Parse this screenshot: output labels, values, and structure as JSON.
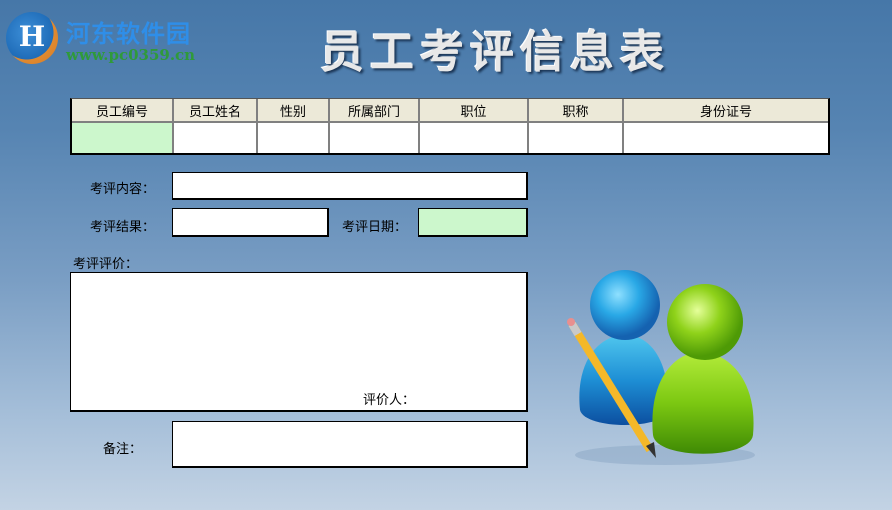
{
  "watermark": {
    "name": "河东软件园",
    "url": "www.pc0359.cn"
  },
  "header": {
    "title": "员工考评信息表"
  },
  "employee_table": {
    "columns": [
      "员工编号",
      "员工姓名",
      "性别",
      "所属部门",
      "职位",
      "职称",
      "身份证号"
    ],
    "row": [
      "",
      "",
      "",
      "",
      "",
      "",
      ""
    ]
  },
  "form": {
    "content_label": "考评内容：",
    "content_value": "",
    "result_label": "考评结果：",
    "result_value": "",
    "date_label": "考评日期：",
    "date_value": "",
    "evaluation_label": "考评评价：",
    "evaluation_value": "",
    "evaluator_label": "评价人：",
    "remarks_label": "备注：",
    "remarks_value": ""
  },
  "colors": {
    "highlight_cell": "#ccf7cc",
    "header_bg": "#ece9d8",
    "background_top": "#4677a8",
    "background_bottom": "#c3d3e4"
  }
}
